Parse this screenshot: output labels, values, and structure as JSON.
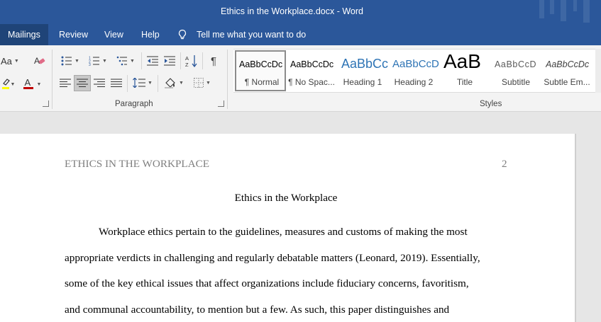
{
  "window": {
    "title": "Ethics in the Workplace.docx  -  Word"
  },
  "ribbon_tabs": [
    "Mailings",
    "Review",
    "View",
    "Help"
  ],
  "tell_me": {
    "label": "Tell me what you want to do",
    "icon": "lightbulb-icon"
  },
  "font_group": {
    "font_size_button_label": "Aa",
    "icons": [
      "change-case-icon",
      "clear-formatting-icon",
      "highlight-icon",
      "font-color-icon"
    ],
    "highlight_color": "#ffff00",
    "font_color": "#c00000"
  },
  "paragraph_group": {
    "label": "Paragraph",
    "icons": [
      "bullets-icon",
      "numbering-icon",
      "multilevel-list-icon",
      "decrease-indent-icon",
      "increase-indent-icon",
      "sort-icon",
      "show-marks-icon",
      "align-left-icon",
      "align-center-icon",
      "align-right-icon",
      "justify-icon",
      "line-spacing-icon",
      "shading-icon",
      "borders-icon"
    ],
    "show_marks_glyph": "¶"
  },
  "styles_group": {
    "label": "Styles",
    "items": [
      {
        "preview": "AaBbCcDc",
        "name": "¶ Normal",
        "selected": true
      },
      {
        "preview": "AaBbCcDc",
        "name": "¶ No Spac...",
        "selected": false
      },
      {
        "preview": "AaBbCc",
        "name": "Heading 1",
        "selected": false
      },
      {
        "preview": "AaBbCcD",
        "name": "Heading 2",
        "selected": false
      },
      {
        "preview": "AaB",
        "name": "Title",
        "selected": false
      },
      {
        "preview": "AaBbCcD",
        "name": "Subtitle",
        "selected": false
      },
      {
        "preview": "AaBbCcDc",
        "name": "Subtle Em...",
        "selected": false
      }
    ]
  },
  "document": {
    "running_head": "ETHICS IN THE WORKPLACE",
    "page_number": "2",
    "title": "Ethics in the Workplace",
    "paragraph_lines": [
      "Workplace ethics pertain to the guidelines, measures and customs of making the most",
      "appropriate verdicts in challenging and regularly debatable matters (Leonard, 2019). Essentially,",
      "some of the key ethical issues that affect organizations include fiduciary concerns, favoritism,",
      "and communal accountability, to mention but a few. As such, this paper distinguishes and"
    ]
  },
  "colors": {
    "accent": "#2b579a",
    "active_tab": "#1f4478",
    "heading_blue": "#2e74b5",
    "header_gray": "#7f7f7f"
  }
}
